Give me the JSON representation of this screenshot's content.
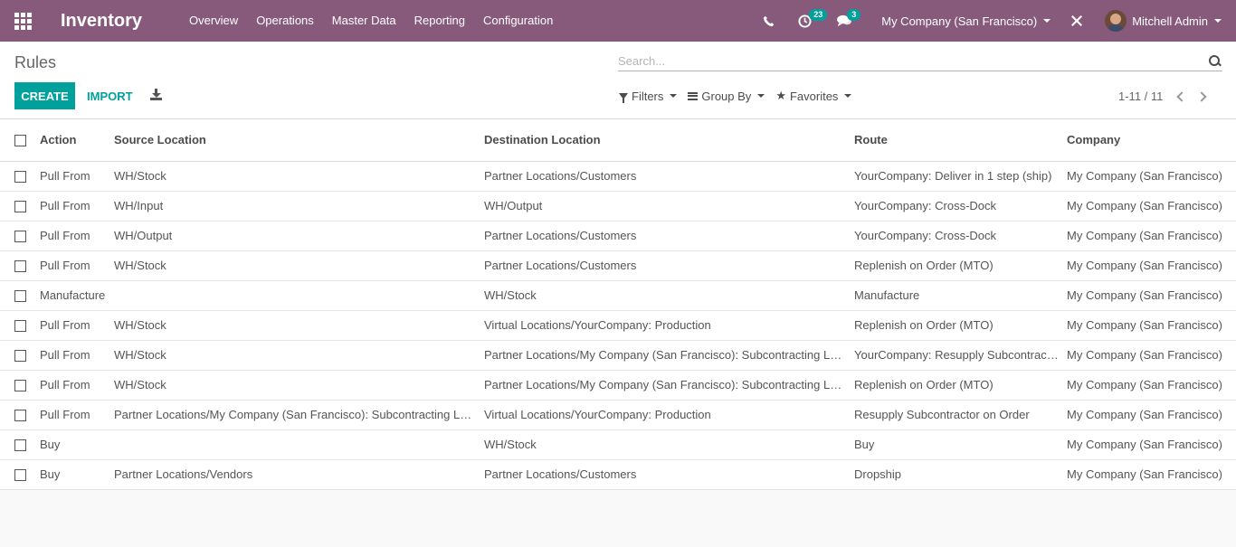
{
  "navbar": {
    "app_title": "Inventory",
    "menu": [
      "Overview",
      "Operations",
      "Master Data",
      "Reporting",
      "Configuration"
    ],
    "activities_badge": "23",
    "messages_badge": "3",
    "company": "My Company (San Francisco)",
    "user": "Mitchell Admin"
  },
  "control_panel": {
    "breadcrumb": "Rules",
    "search_placeholder": "Search...",
    "create_label": "CREATE",
    "import_label": "IMPORT",
    "filters_label": "Filters",
    "group_by_label": "Group By",
    "favorites_label": "Favorites",
    "pager": "1-11 / 11"
  },
  "table": {
    "headers": {
      "action": "Action",
      "source": "Source Location",
      "destination": "Destination Location",
      "route": "Route",
      "company": "Company"
    },
    "rows": [
      {
        "action": "Pull From",
        "source": "WH/Stock",
        "destination": "Partner Locations/Customers",
        "route": "YourCompany: Deliver in 1 step (ship)",
        "company": "My Company (San Francisco)"
      },
      {
        "action": "Pull From",
        "source": "WH/Input",
        "destination": "WH/Output",
        "route": "YourCompany: Cross-Dock",
        "company": "My Company (San Francisco)"
      },
      {
        "action": "Pull From",
        "source": "WH/Output",
        "destination": "Partner Locations/Customers",
        "route": "YourCompany: Cross-Dock",
        "company": "My Company (San Francisco)"
      },
      {
        "action": "Pull From",
        "source": "WH/Stock",
        "destination": "Partner Locations/Customers",
        "route": "Replenish on Order (MTO)",
        "company": "My Company (San Francisco)"
      },
      {
        "action": "Manufacture",
        "source": "",
        "destination": "WH/Stock",
        "route": "Manufacture",
        "company": "My Company (San Francisco)"
      },
      {
        "action": "Pull From",
        "source": "WH/Stock",
        "destination": "Virtual Locations/YourCompany: Production",
        "route": "Replenish on Order (MTO)",
        "company": "My Company (San Francisco)"
      },
      {
        "action": "Pull From",
        "source": "WH/Stock",
        "destination": "Partner Locations/My Company (San Francisco): Subcontracting Location",
        "route": "YourCompany: Resupply Subcontractor",
        "company": "My Company (San Francisco)"
      },
      {
        "action": "Pull From",
        "source": "WH/Stock",
        "destination": "Partner Locations/My Company (San Francisco): Subcontracting Location",
        "route": "Replenish on Order (MTO)",
        "company": "My Company (San Francisco)"
      },
      {
        "action": "Pull From",
        "source": "Partner Locations/My Company (San Francisco): Subcontracting Location",
        "destination": "Virtual Locations/YourCompany: Production",
        "route": "Resupply Subcontractor on Order",
        "company": "My Company (San Francisco)"
      },
      {
        "action": "Buy",
        "source": "",
        "destination": "WH/Stock",
        "route": "Buy",
        "company": "My Company (San Francisco)"
      },
      {
        "action": "Buy",
        "source": "Partner Locations/Vendors",
        "destination": "Partner Locations/Customers",
        "route": "Dropship",
        "company": "My Company (San Francisco)"
      }
    ]
  }
}
